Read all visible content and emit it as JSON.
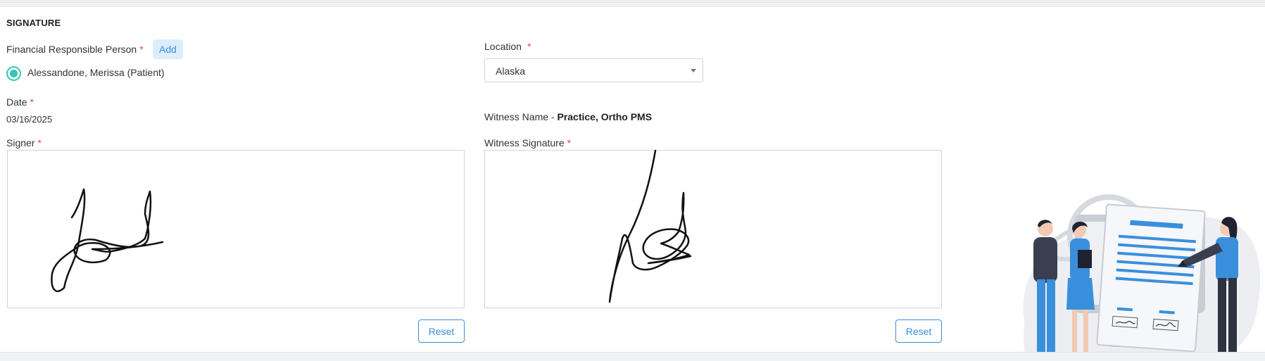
{
  "section": {
    "title": "SIGNATURE"
  },
  "financial": {
    "label": "Financial Responsible Person",
    "required": "*",
    "add_label": "Add",
    "selected_person": "Alessandone, Merissa (Patient)"
  },
  "location": {
    "label": "Location",
    "required": "*",
    "selected": "Alaska"
  },
  "date": {
    "label": "Date",
    "required": "*",
    "value": "03/16/2025"
  },
  "witness": {
    "name_label": "Witness Name -",
    "name_value": "Practice, Ortho PMS",
    "signature_label": "Witness Signature",
    "required": "*"
  },
  "signer": {
    "label": "Signer",
    "required": "*"
  },
  "buttons": {
    "reset_label": "Reset"
  },
  "colors": {
    "accent": "#3a8fdc",
    "radio": "#35c6b2",
    "required": "#e0454a"
  },
  "icons": {
    "dropdown": "chevron-down-icon"
  }
}
